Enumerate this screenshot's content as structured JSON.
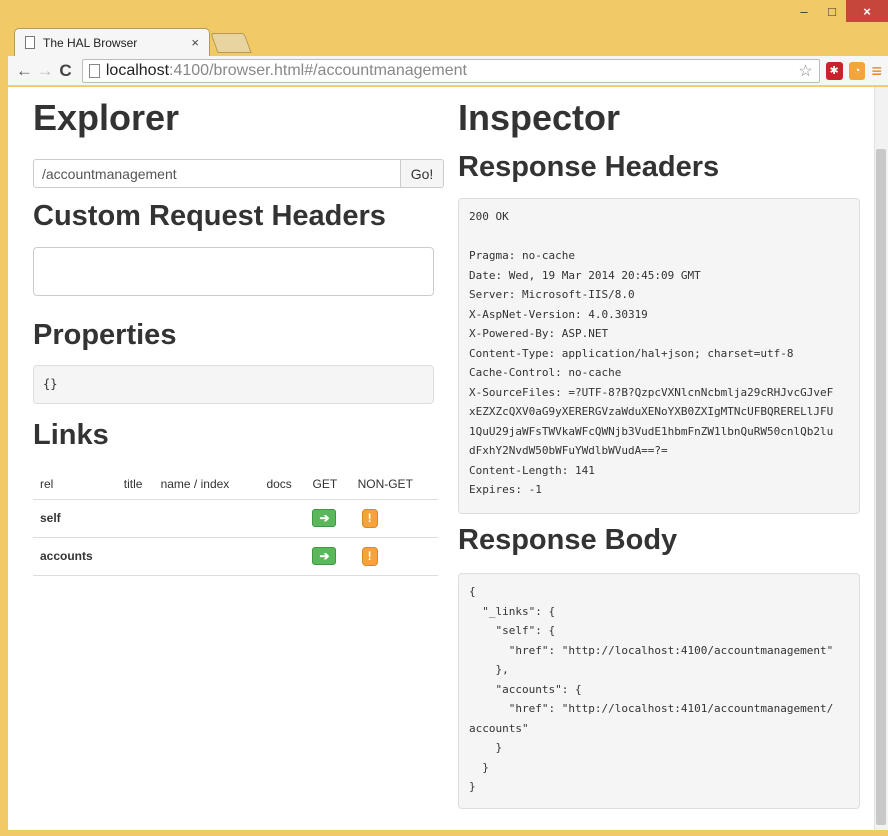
{
  "browser": {
    "tab_title": "The HAL Browser",
    "tab_close": "×",
    "url_host": "localhost",
    "url_rest": ":4100/browser.html#/accountmanagement",
    "win_minimize": "–",
    "win_maximize": "□",
    "win_close": "×"
  },
  "explorer": {
    "title": "Explorer",
    "url_value": "/accountmanagement",
    "go_label": "Go!",
    "custom_headers_title": "Custom Request Headers",
    "properties_title": "Properties",
    "properties_value": "{}",
    "links_title": "Links",
    "links_columns": [
      "rel",
      "title",
      "name / index",
      "docs",
      "GET",
      "NON-GET"
    ],
    "links_rows": [
      {
        "rel": "self",
        "title": "",
        "name": "",
        "docs": ""
      },
      {
        "rel": "accounts",
        "title": "",
        "name": "",
        "docs": ""
      }
    ]
  },
  "inspector": {
    "title": "Inspector",
    "response_headers_title": "Response Headers",
    "response_headers": "200 OK\n\nPragma: no-cache\nDate: Wed, 19 Mar 2014 20:45:09 GMT\nServer: Microsoft-IIS/8.0\nX-AspNet-Version: 4.0.30319\nX-Powered-By: ASP.NET\nContent-Type: application/hal+json; charset=utf-8\nCache-Control: no-cache\nX-SourceFiles: =?UTF-8?B?QzpcVXNlcnNcbmlja29cRHJvcGJveF\nxEZXZcQXV0aG9yXERERGVzaWduXENoYXB0ZXIgMTNcUFBQRERELlJFU\n1QuU29jaWFsTWVkaWFcQWNjb3VudE1hbmFnZW1lbnQuRW50cnlQb2lu\ndFxhY2NvdW50bWFuYWdlbWVudA==?=\nContent-Length: 141\nExpires: -1",
    "response_body_title": "Response Body",
    "response_body": "{\n  \"_links\": {\n    \"self\": {\n      \"href\": \"http://localhost:4100/accountmanagement\"\n    },\n    \"accounts\": {\n      \"href\": \"http://localhost:4101/accountmanagement/\naccounts\"\n    }\n  }\n}"
  },
  "icons": {
    "back": "←",
    "forward": "→",
    "reload": "C",
    "star": "☆",
    "get_arrow": "➔",
    "nonget_bang": "!",
    "menu": "≡"
  }
}
